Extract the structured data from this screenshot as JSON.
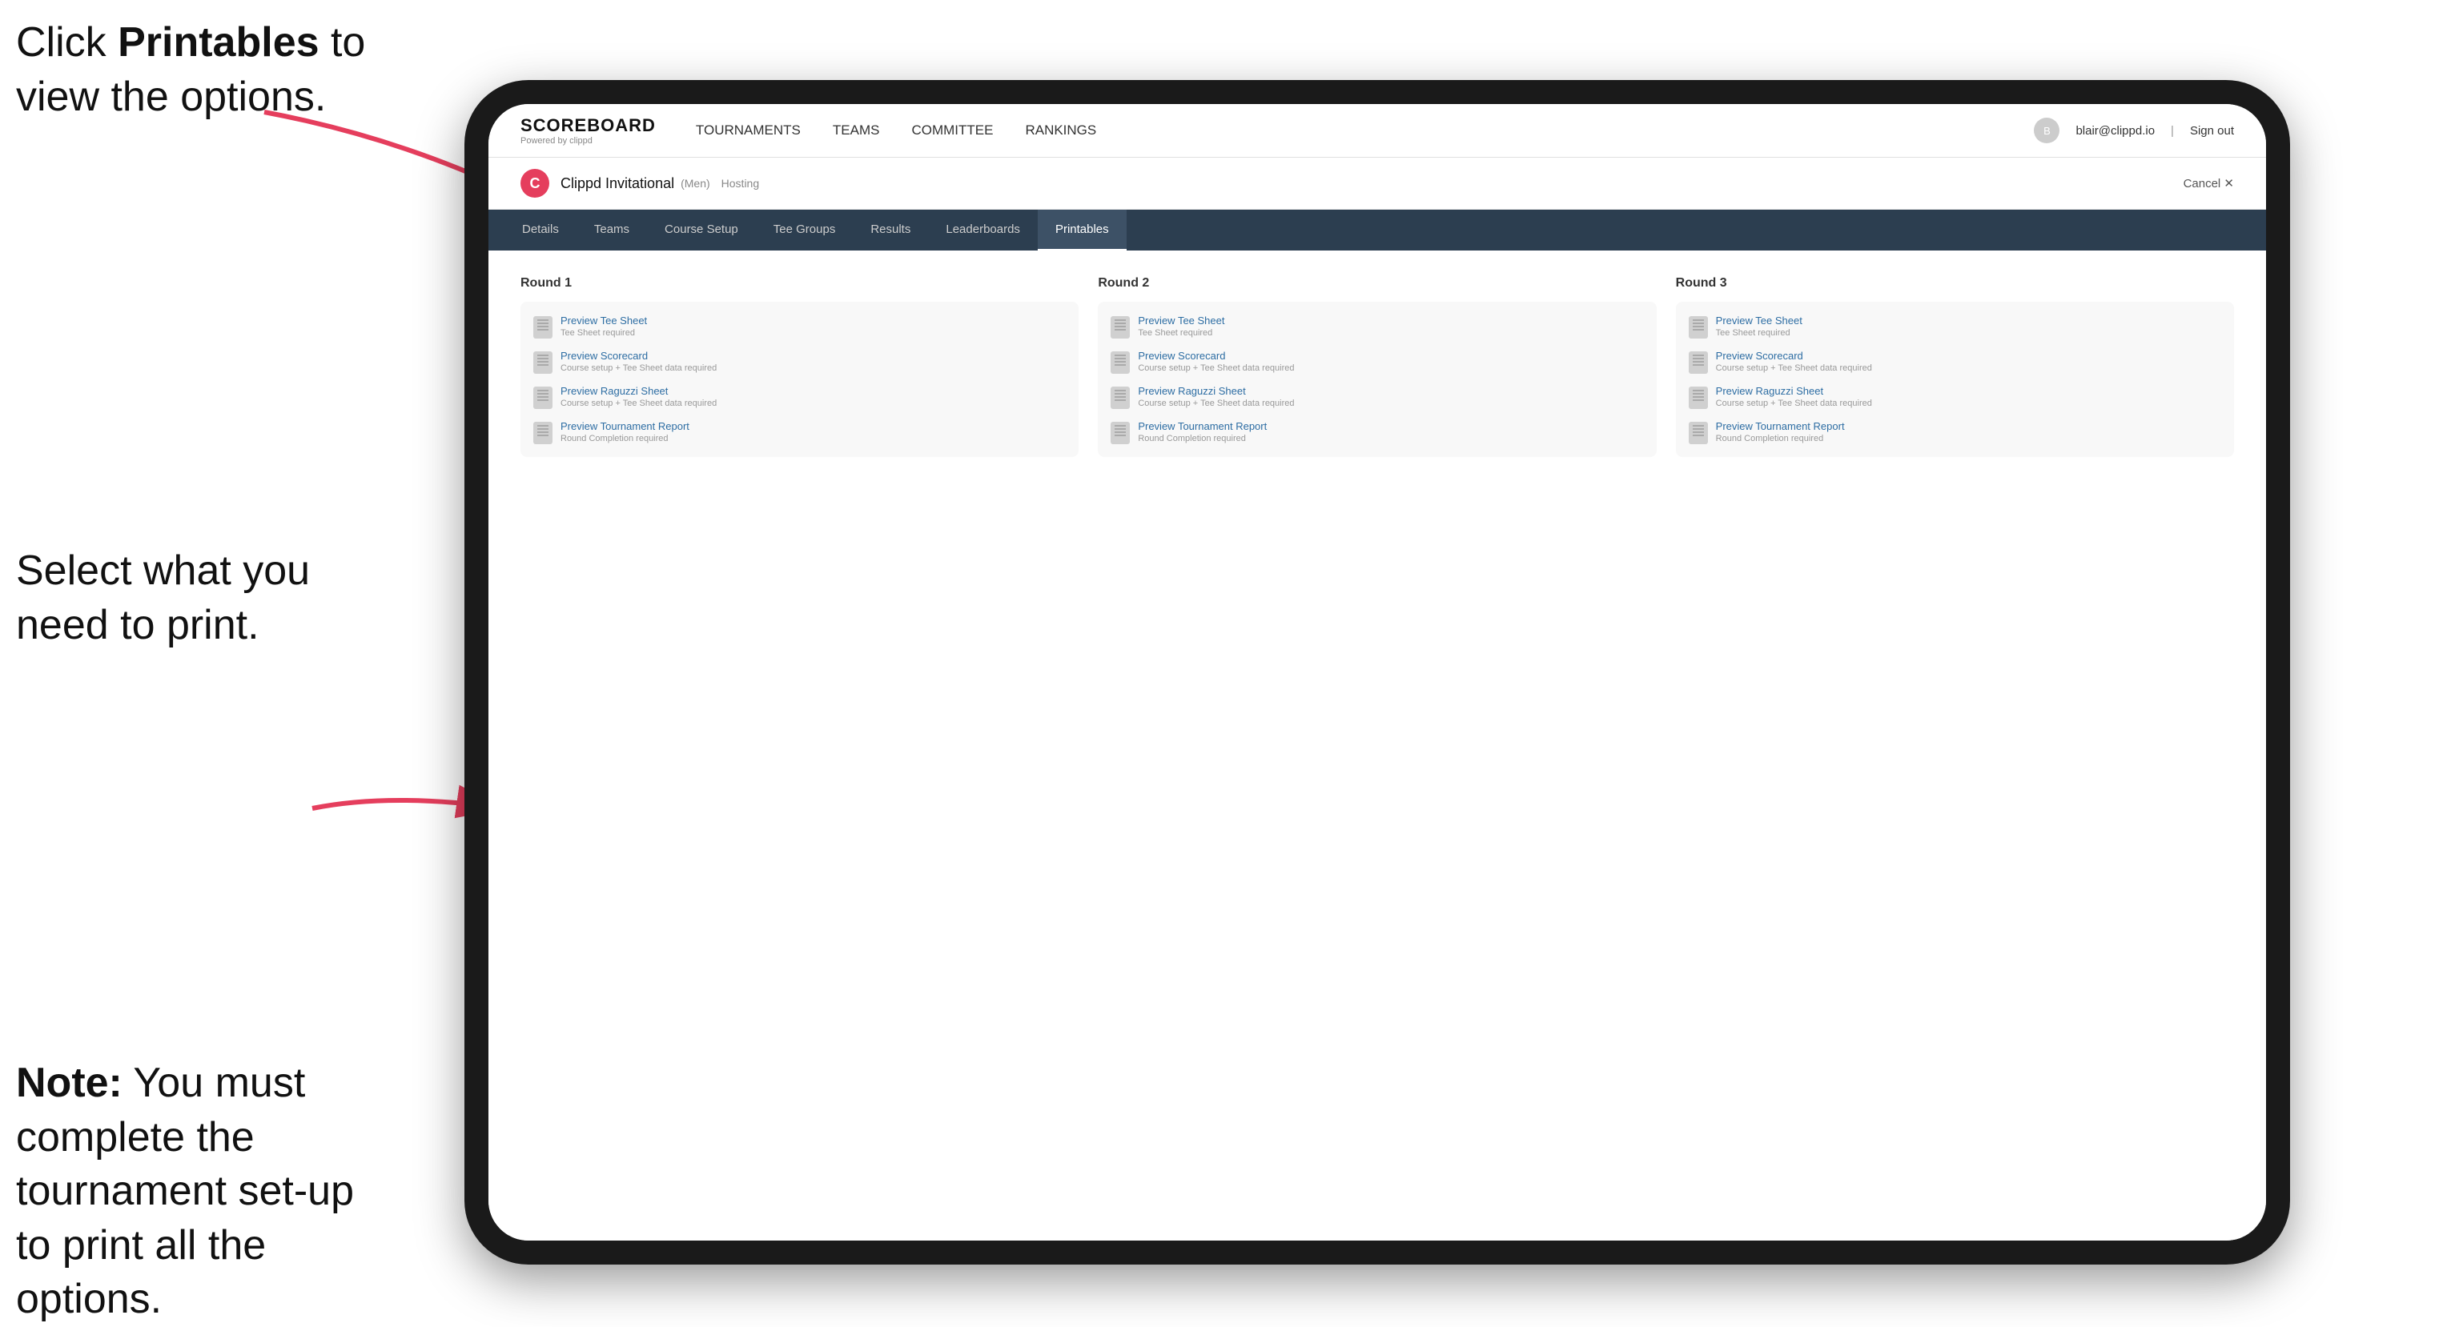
{
  "annotations": {
    "top": {
      "prefix": "Click ",
      "bold": "Printables",
      "suffix": " to view the options."
    },
    "middle": {
      "text": "Select what you need to print."
    },
    "bottom": {
      "bold": "Note:",
      "suffix": " You must complete the tournament set-up to print all the options."
    }
  },
  "topNav": {
    "brand": "SCOREBOARD",
    "brand_sub": "Powered by clippd",
    "links": [
      "TOURNAMENTS",
      "TEAMS",
      "COMMITTEE",
      "RANKINGS"
    ],
    "user_email": "blair@clippd.io",
    "sign_out": "Sign out"
  },
  "tournamentHeader": {
    "logo": "C",
    "name": "Clippd Invitational",
    "tag": "(Men)",
    "status": "Hosting",
    "cancel": "Cancel ✕"
  },
  "tabs": {
    "items": [
      "Details",
      "Teams",
      "Course Setup",
      "Tee Groups",
      "Results",
      "Leaderboards",
      "Printables"
    ],
    "active": "Printables"
  },
  "rounds": [
    {
      "title": "Round 1",
      "items": [
        {
          "label": "Preview Tee Sheet",
          "sub": "Tee Sheet required"
        },
        {
          "label": "Preview Scorecard",
          "sub": "Course setup + Tee Sheet data required"
        },
        {
          "label": "Preview Raguzzi Sheet",
          "sub": "Course setup + Tee Sheet data required"
        },
        {
          "label": "Preview Tournament Report",
          "sub": "Round Completion required"
        }
      ]
    },
    {
      "title": "Round 2",
      "items": [
        {
          "label": "Preview Tee Sheet",
          "sub": "Tee Sheet required"
        },
        {
          "label": "Preview Scorecard",
          "sub": "Course setup + Tee Sheet data required"
        },
        {
          "label": "Preview Raguzzi Sheet",
          "sub": "Course setup + Tee Sheet data required"
        },
        {
          "label": "Preview Tournament Report",
          "sub": "Round Completion required"
        }
      ]
    },
    {
      "title": "Round 3",
      "items": [
        {
          "label": "Preview Tee Sheet",
          "sub": "Tee Sheet required"
        },
        {
          "label": "Preview Scorecard",
          "sub": "Course setup + Tee Sheet data required"
        },
        {
          "label": "Preview Raguzzi Sheet",
          "sub": "Course setup + Tee Sheet data required"
        },
        {
          "label": "Preview Tournament Report",
          "sub": "Round Completion required"
        }
      ]
    }
  ]
}
